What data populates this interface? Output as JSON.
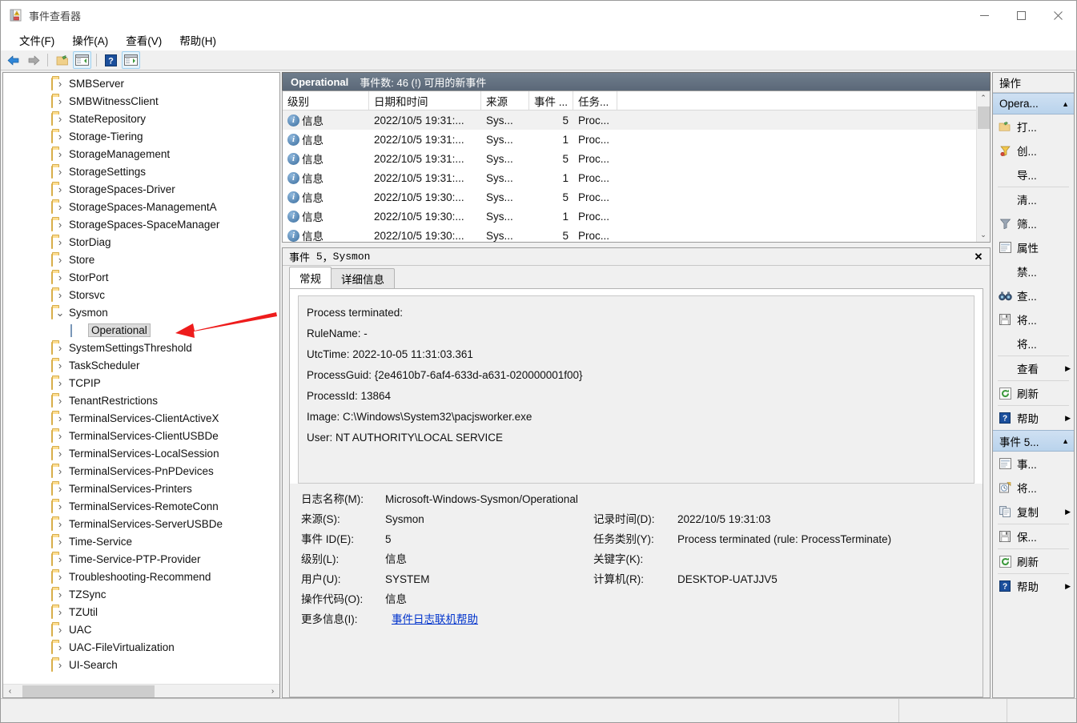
{
  "window": {
    "title": "事件查看器",
    "icon": "event-viewer-icon",
    "controls": {
      "minimize": "—",
      "maximize": "☐",
      "close": "✕"
    }
  },
  "menubar": {
    "items": [
      "文件(F)",
      "操作(A)",
      "查看(V)",
      "帮助(H)"
    ]
  },
  "toolbar": {
    "buttons": [
      {
        "name": "back-icon",
        "glyph": "◀"
      },
      {
        "name": "forward-icon",
        "glyph": "▶"
      },
      {
        "name": "show-hide-console-tree-icon",
        "glyph": "folder"
      },
      {
        "name": "properties-window-icon",
        "glyph": "window"
      },
      {
        "name": "help-icon",
        "glyph": "?"
      },
      {
        "name": "show-hide-action-pane-icon",
        "glyph": "window2"
      }
    ]
  },
  "tree": {
    "items": [
      {
        "label": "SMBServer",
        "icon": "folder-icon",
        "expandable": true,
        "level": 1
      },
      {
        "label": "SMBWitnessClient",
        "icon": "folder-icon",
        "expandable": true,
        "level": 1
      },
      {
        "label": "StateRepository",
        "icon": "folder-icon",
        "expandable": true,
        "level": 1
      },
      {
        "label": "Storage-Tiering",
        "icon": "folder-icon",
        "expandable": true,
        "level": 1
      },
      {
        "label": "StorageManagement",
        "icon": "folder-icon",
        "expandable": true,
        "level": 1
      },
      {
        "label": "StorageSettings",
        "icon": "folder-icon",
        "expandable": true,
        "level": 1
      },
      {
        "label": "StorageSpaces-Driver",
        "icon": "folder-icon",
        "expandable": true,
        "level": 1
      },
      {
        "label": "StorageSpaces-ManagementA",
        "icon": "folder-icon",
        "expandable": true,
        "level": 1
      },
      {
        "label": "StorageSpaces-SpaceManager",
        "icon": "folder-icon",
        "expandable": true,
        "level": 1
      },
      {
        "label": "StorDiag",
        "icon": "folder-icon",
        "expandable": true,
        "level": 1
      },
      {
        "label": "Store",
        "icon": "folder-icon",
        "expandable": true,
        "level": 1
      },
      {
        "label": "StorPort",
        "icon": "folder-icon",
        "expandable": true,
        "level": 1
      },
      {
        "label": "Storsvc",
        "icon": "folder-icon",
        "expandable": true,
        "level": 1
      },
      {
        "label": "Sysmon",
        "icon": "folder-icon",
        "expandable": true,
        "expanded": true,
        "level": 1
      },
      {
        "label": "Operational",
        "icon": "log-icon",
        "expandable": false,
        "level": 2,
        "selected": true
      },
      {
        "label": "SystemSettingsThreshold",
        "icon": "folder-icon",
        "expandable": true,
        "level": 1
      },
      {
        "label": "TaskScheduler",
        "icon": "folder-icon",
        "expandable": true,
        "level": 1
      },
      {
        "label": "TCPIP",
        "icon": "folder-icon",
        "expandable": true,
        "level": 1
      },
      {
        "label": "TenantRestrictions",
        "icon": "folder-icon",
        "expandable": true,
        "level": 1
      },
      {
        "label": "TerminalServices-ClientActiveX",
        "icon": "folder-icon",
        "expandable": true,
        "level": 1
      },
      {
        "label": "TerminalServices-ClientUSBDe",
        "icon": "folder-icon",
        "expandable": true,
        "level": 1
      },
      {
        "label": "TerminalServices-LocalSession",
        "icon": "folder-icon",
        "expandable": true,
        "level": 1
      },
      {
        "label": "TerminalServices-PnPDevices",
        "icon": "folder-icon",
        "expandable": true,
        "level": 1
      },
      {
        "label": "TerminalServices-Printers",
        "icon": "folder-icon",
        "expandable": true,
        "level": 1
      },
      {
        "label": "TerminalServices-RemoteConn",
        "icon": "folder-icon",
        "expandable": true,
        "level": 1
      },
      {
        "label": "TerminalServices-ServerUSBDe",
        "icon": "folder-icon",
        "expandable": true,
        "level": 1
      },
      {
        "label": "Time-Service",
        "icon": "folder-icon",
        "expandable": true,
        "level": 1
      },
      {
        "label": "Time-Service-PTP-Provider",
        "icon": "folder-icon",
        "expandable": true,
        "level": 1
      },
      {
        "label": "Troubleshooting-Recommend",
        "icon": "folder-icon",
        "expandable": true,
        "level": 1
      },
      {
        "label": "TZSync",
        "icon": "folder-icon",
        "expandable": true,
        "level": 1
      },
      {
        "label": "TZUtil",
        "icon": "folder-icon",
        "expandable": true,
        "level": 1
      },
      {
        "label": "UAC",
        "icon": "folder-icon",
        "expandable": true,
        "level": 1
      },
      {
        "label": "UAC-FileVirtualization",
        "icon": "folder-icon",
        "expandable": true,
        "level": 1
      },
      {
        "label": "UI-Search",
        "icon": "folder-icon",
        "expandable": true,
        "level": 1
      }
    ]
  },
  "log": {
    "header_title": "Operational",
    "header_subtitle": "事件数: 46 (!) 可用的新事件",
    "columns": [
      "级别",
      "日期和时间",
      "来源",
      "事件 ...",
      "任务..."
    ],
    "rows": [
      {
        "level": "信息",
        "datetime": "2022/10/5 19:31:...",
        "source": "Sys...",
        "event_id": "5",
        "task": "Proc...",
        "selected": true
      },
      {
        "level": "信息",
        "datetime": "2022/10/5 19:31:...",
        "source": "Sys...",
        "event_id": "1",
        "task": "Proc..."
      },
      {
        "level": "信息",
        "datetime": "2022/10/5 19:31:...",
        "source": "Sys...",
        "event_id": "5",
        "task": "Proc..."
      },
      {
        "level": "信息",
        "datetime": "2022/10/5 19:31:...",
        "source": "Sys...",
        "event_id": "1",
        "task": "Proc..."
      },
      {
        "level": "信息",
        "datetime": "2022/10/5 19:30:...",
        "source": "Sys...",
        "event_id": "5",
        "task": "Proc..."
      },
      {
        "level": "信息",
        "datetime": "2022/10/5 19:30:...",
        "source": "Sys...",
        "event_id": "1",
        "task": "Proc..."
      },
      {
        "level": "信息",
        "datetime": "2022/10/5 19:30:...",
        "source": "Sys...",
        "event_id": "5",
        "task": "Proc..."
      }
    ]
  },
  "detail": {
    "title_prefix": "事件",
    "title_id": "5",
    "title_sep": "，",
    "title_source": "Sysmon",
    "close_glyph": "✕",
    "tabs": [
      {
        "label": "常规",
        "active": true
      },
      {
        "label": "详细信息",
        "active": false
      }
    ],
    "description_lines": [
      "Process terminated:",
      "RuleName: -",
      "UtcTime: 2022-10-05 11:31:03.361",
      "ProcessGuid: {2e4610b7-6af4-633d-a631-020000001f00}",
      "ProcessId: 13864",
      "Image: C:\\Windows\\System32\\pacjsworker.exe",
      "User: NT AUTHORITY\\LOCAL SERVICE"
    ],
    "meta": {
      "log_name_label": "日志名称(M):",
      "log_name_value": "Microsoft-Windows-Sysmon/Operational",
      "source_label": "来源(S):",
      "source_value": "Sysmon",
      "logged_label": "记录时间(D):",
      "logged_value": "2022/10/5 19:31:03",
      "event_id_label": "事件 ID(E):",
      "event_id_value": "5",
      "task_category_label": "任务类别(Y):",
      "task_category_value": "Process terminated (rule: ProcessTerminate)",
      "level_label": "级别(L):",
      "level_value": "信息",
      "keywords_label": "关键字(K):",
      "keywords_value": "",
      "user_label": "用户(U):",
      "user_value": "SYSTEM",
      "computer_label": "计算机(R):",
      "computer_value": "DESKTOP-UATJJV5",
      "opcode_label": "操作代码(O):",
      "opcode_value": "信息",
      "more_info_label": "更多信息(I):",
      "more_info_link": "事件日志联机帮助"
    }
  },
  "actions": {
    "title": "操作",
    "groups": [
      {
        "header": "Opera...",
        "collapse_glyph": "▲",
        "items": [
          {
            "label": "打...",
            "icon": "open-log-icon",
            "submenu": false,
            "sep_after": false
          },
          {
            "label": "创...",
            "icon": "create-custom-view-icon",
            "submenu": false,
            "sep_after": false
          },
          {
            "label": "导...",
            "icon": "none",
            "submenu": false,
            "sep_after": true
          },
          {
            "label": "清...",
            "icon": "none",
            "submenu": false,
            "sep_after": false
          },
          {
            "label": "筛...",
            "icon": "filter-icon",
            "submenu": false,
            "sep_after": false
          },
          {
            "label": "属性",
            "icon": "properties-icon",
            "submenu": false,
            "sep_after": false
          },
          {
            "label": "禁...",
            "icon": "none",
            "submenu": false,
            "sep_after": false
          },
          {
            "label": "查...",
            "icon": "find-icon",
            "submenu": false,
            "sep_after": false
          },
          {
            "label": "将...",
            "icon": "save-icon",
            "submenu": false,
            "sep_after": false
          },
          {
            "label": "将...",
            "icon": "none",
            "submenu": false,
            "sep_after": true
          },
          {
            "label": "查看",
            "icon": "none",
            "submenu": true,
            "sep_after": true
          },
          {
            "label": "刷新",
            "icon": "refresh-icon",
            "submenu": false,
            "sep_after": true
          },
          {
            "label": "帮助",
            "icon": "help-icon",
            "submenu": true,
            "sep_after": false
          }
        ]
      },
      {
        "header": "事件 5...",
        "collapse_glyph": "▲",
        "items": [
          {
            "label": "事...",
            "icon": "event-properties-icon",
            "submenu": false,
            "sep_after": false
          },
          {
            "label": "将...",
            "icon": "attach-task-icon",
            "submenu": false,
            "sep_after": false
          },
          {
            "label": "复制",
            "icon": "copy-icon",
            "submenu": true,
            "sep_after": true
          },
          {
            "label": "保...",
            "icon": "save-icon",
            "submenu": false,
            "sep_after": true
          },
          {
            "label": "刷新",
            "icon": "refresh-icon",
            "submenu": false,
            "sep_after": true
          },
          {
            "label": "帮助",
            "icon": "help-icon",
            "submenu": true,
            "sep_after": false
          }
        ]
      }
    ]
  },
  "annotation": {
    "arrow": "red-pointer-arrow",
    "color": "#ee1c1c",
    "points_to": "Operational"
  },
  "colors": {
    "accent_header": "#5b6878",
    "action_group_header": "#bed6ee",
    "selection": "#dcdcdc",
    "link": "#0033cc",
    "arrow_red": "#ee1c1c"
  }
}
